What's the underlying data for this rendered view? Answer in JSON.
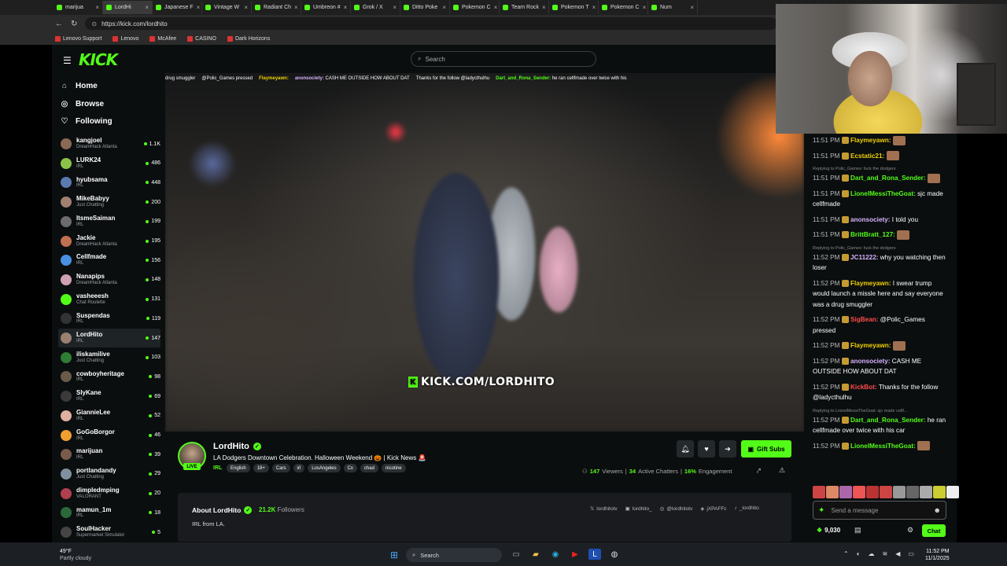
{
  "browser": {
    "tabs": [
      {
        "label": "marijua",
        "active": false
      },
      {
        "label": "LordHi",
        "active": true
      },
      {
        "label": "Japanese F",
        "active": false
      },
      {
        "label": "Vintage W",
        "active": false
      },
      {
        "label": "Radiant Ch",
        "active": false
      },
      {
        "label": "Umbreon #",
        "active": false
      },
      {
        "label": "Grok / X",
        "active": false
      },
      {
        "label": "Ditto Poke",
        "active": false
      },
      {
        "label": "Pokemon C",
        "active": false
      },
      {
        "label": "Team Rock",
        "active": false
      },
      {
        "label": "Pokemon T",
        "active": false
      },
      {
        "label": "Pokemon C",
        "active": false
      },
      {
        "label": "Num",
        "active": false
      }
    ],
    "url": "https://kick.com/lordhito",
    "bookmarks": [
      "Lenovo Support",
      "Lenovo",
      "McAfee",
      "CASINO",
      "Dark Horizons"
    ]
  },
  "header": {
    "logo": "KICK",
    "search_placeholder": "Search"
  },
  "sidebar": {
    "nav": [
      {
        "label": "Home",
        "icon": "home-icon"
      },
      {
        "label": "Browse",
        "icon": "compass-icon"
      },
      {
        "label": "Following",
        "icon": "heart-icon"
      }
    ],
    "channels": [
      {
        "name": "kangjoel",
        "category": "DreamHack Atlanta",
        "viewers": "1.1K",
        "color": "#8a6a55",
        "active": false
      },
      {
        "name": "LURK24",
        "category": "IRL",
        "viewers": "486",
        "color": "#8bc34a",
        "active": false
      },
      {
        "name": "hyubsama",
        "category": "IRL",
        "viewers": "448",
        "color": "#5a7ab0",
        "active": false
      },
      {
        "name": "MikeBabyy",
        "category": "Just Chatting",
        "viewers": "200",
        "color": "#a08070",
        "active": false
      },
      {
        "name": "ItsmeSaiman",
        "category": "IRL",
        "viewers": "199",
        "color": "#6c6c6c",
        "active": false
      },
      {
        "name": "Jackie",
        "category": "DreamHack Atlanta",
        "viewers": "195",
        "color": "#c07050",
        "active": false
      },
      {
        "name": "Cellfmade",
        "category": "IRL",
        "viewers": "156",
        "color": "#4a90e2",
        "active": false
      },
      {
        "name": "Nanapips",
        "category": "DreamHack Atlanta",
        "viewers": "148",
        "color": "#d0a0b0",
        "active": false
      },
      {
        "name": "vasheeesh",
        "category": "Chat Roulette",
        "viewers": "131",
        "color": "#53fc18",
        "active": false
      },
      {
        "name": "Suspendas",
        "category": "IRL",
        "viewers": "119",
        "color": "#333333",
        "active": false
      },
      {
        "name": "LordHito",
        "category": "IRL",
        "viewers": "147",
        "color": "#9a8070",
        "active": true
      },
      {
        "name": "iliskamilive",
        "category": "Just Chatting",
        "viewers": "103",
        "color": "#2e7d32",
        "active": false
      },
      {
        "name": "cowboyheritage",
        "category": "IRL",
        "viewers": "98",
        "color": "#6a5a4a",
        "active": false
      },
      {
        "name": "SlyKane",
        "category": "IRL",
        "viewers": "69",
        "color": "#3a3a3a",
        "active": false
      },
      {
        "name": "GiannieLee",
        "category": "IRL",
        "viewers": "52",
        "color": "#e0b0a0",
        "active": false
      },
      {
        "name": "GoGoBorgor",
        "category": "IRL",
        "viewers": "46",
        "color": "#f0a030",
        "active": false
      },
      {
        "name": "marijuan",
        "category": "IRL",
        "viewers": "39",
        "color": "#7a5a4a",
        "active": false
      },
      {
        "name": "portlandandy",
        "category": "Just Chatting",
        "viewers": "29",
        "color": "#8090a0",
        "active": false
      },
      {
        "name": "dimpledmping",
        "category": "VALORANT",
        "viewers": "20",
        "color": "#b04050",
        "active": false
      },
      {
        "name": "mamun_1m",
        "category": "IRL",
        "viewers": "18",
        "color": "#2a6a3a",
        "active": false
      },
      {
        "name": "SoulHacker",
        "category": "Supermarket Simulator",
        "viewers": "5",
        "color": "#444",
        "active": false
      }
    ]
  },
  "video": {
    "ticker": [
      {
        "user": "",
        "text": "drug smuggler",
        "color": ""
      },
      {
        "user": "",
        "text": "@Polic_Games pressed",
        "color": ""
      },
      {
        "user": "Flaymeyawn:",
        "text": "",
        "color": "#f0d000"
      },
      {
        "user": "anonsociety:",
        "text": "CASH ME OUTSIDE HOW ABOUT DAT",
        "color": "#d6b4ff"
      },
      {
        "user": "",
        "text": "Thanks for the follow @ladycthulhu",
        "color": ""
      },
      {
        "user": "Dart_and_Rona_Sender:",
        "text": "he ran cellfmade over twice with his",
        "color": "#53fc18"
      }
    ],
    "watermark": "KICK.COM/LORDHITO"
  },
  "stream": {
    "streamer": "LordHito",
    "live_label": "LIVE",
    "title": "LA Dodgers Downtown Celebration. Halloween Weekend 🎃 | Kick News 🚨",
    "category": "IRL",
    "tags": [
      "English",
      "18+",
      "Cars",
      "irl",
      "LosAngeles",
      "Cx",
      "chad",
      "nicotine"
    ],
    "gift_subs_label": "Gift Subs",
    "viewers": "147",
    "viewers_label": "Viewers",
    "chatters": "34",
    "chatters_label": "Active Chatters",
    "engagement": "16%",
    "engagement_label": "Engagement"
  },
  "about": {
    "title": "About LordHito",
    "followers": "21.2K",
    "followers_label": "Followers",
    "bio": "IRL from LA.",
    "socials": [
      "lordhitotv",
      "lordhito_",
      "@lordhitotv",
      "jXPAFFc",
      "_lordhito"
    ]
  },
  "chat": {
    "messages": [
      {
        "time": "11:51 PM",
        "user": "Flaymeyawn:",
        "color": "#f0d000",
        "text": "",
        "reply": ""
      },
      {
        "time": "11:51 PM",
        "user": "Ecstatic21:",
        "color": "#f0d000",
        "text": "",
        "reply": ""
      },
      {
        "time": "11:51 PM",
        "user": "Dart_and_Rona_Sender:",
        "color": "#53fc18",
        "text": "",
        "reply": "Replying to Polic_Games: fuck the dodgers"
      },
      {
        "time": "11:51 PM",
        "user": "LionelMessiTheGoat:",
        "color": "#53fc18",
        "text": "sjc made cellfmade",
        "reply": ""
      },
      {
        "time": "11:51 PM",
        "user": "anonsociety:",
        "color": "#d6b4ff",
        "text": "I told you",
        "reply": ""
      },
      {
        "time": "11:51 PM",
        "user": "BrittBratt_127:",
        "color": "#53fc18",
        "text": "",
        "reply": ""
      },
      {
        "time": "11:52 PM",
        "user": "JC11222:",
        "color": "#d6b4ff",
        "text": "why you watching then loser",
        "reply": "Replying to Polic_Games: fuck the dodgers"
      },
      {
        "time": "11:52 PM",
        "user": "Flaymeyawn:",
        "color": "#f0d000",
        "text": "I swear trump would launch a missle here and say everyone was a drug smuggler",
        "reply": ""
      },
      {
        "time": "11:52 PM",
        "user": "SigBean:",
        "color": "#ff4d4d",
        "text": "@Polic_Games pressed",
        "reply": ""
      },
      {
        "time": "11:52 PM",
        "user": "Flaymeyawn:",
        "color": "#f0d000",
        "text": "",
        "reply": ""
      },
      {
        "time": "11:52 PM",
        "user": "anonsociety:",
        "color": "#d6b4ff",
        "text": "CASH ME OUTSIDE HOW ABOUT DAT",
        "reply": ""
      },
      {
        "time": "11:52 PM",
        "user": "KickBot:",
        "color": "#ff4d4d",
        "text": "Thanks for the follow @ladycthulhu",
        "reply": ""
      },
      {
        "time": "11:52 PM",
        "user": "Dart_and_Rona_Sender:",
        "color": "#53fc18",
        "text": "he ran cellfmade over twice with his car",
        "reply": "Replying to LionelMessiTheGoat: sjc made cellf..."
      },
      {
        "time": "11:52 PM",
        "user": "LionelMessiTheGoat:",
        "color": "#53fc18",
        "text": "",
        "reply": ""
      }
    ],
    "input_placeholder": "Send a message",
    "points": "9,030",
    "send_label": "Chat"
  },
  "taskbar": {
    "temperature": "49°F",
    "weather": "Partly cloudy",
    "search_placeholder": "Search",
    "time": "11:52 PM",
    "date": "11/1/2025"
  },
  "colors": {
    "accent": "#53fc18",
    "background": "#0b0e0f"
  }
}
